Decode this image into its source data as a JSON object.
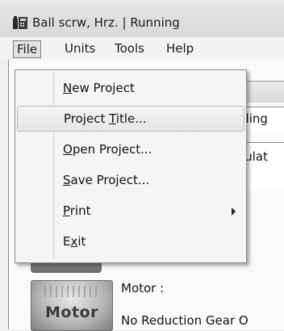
{
  "window": {
    "title": "Ball scrw, Hrz.  | Running"
  },
  "menubar": [
    {
      "label": "File",
      "open": true
    },
    {
      "label": "Units"
    },
    {
      "label": "Tools"
    },
    {
      "label": "Help"
    }
  ],
  "file_menu": {
    "items": [
      {
        "pre": "",
        "accel": "N",
        "post": "ew Project"
      },
      {
        "pre": "Project ",
        "accel": "T",
        "post": "itle..."
      },
      {
        "pre": "",
        "accel": "O",
        "post": "pen Project..."
      },
      {
        "pre": "",
        "accel": "S",
        "post": "ave Project..."
      },
      {
        "pre": "",
        "accel": "P",
        "post": "rint"
      },
      {
        "pre": "E",
        "accel": "x",
        "post": "it"
      }
    ]
  },
  "background": {
    "fragment_1": "pling",
    "fragment_2": "culat"
  },
  "motor": {
    "button_label": "Motor",
    "title": "Motor :",
    "subtitle": "No Reduction Gear O"
  }
}
